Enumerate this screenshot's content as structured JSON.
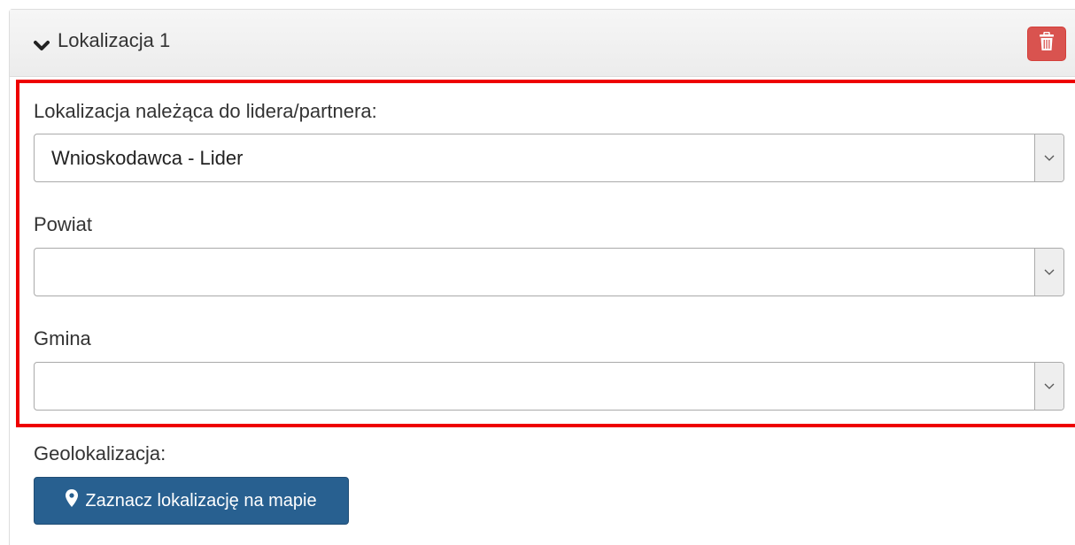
{
  "panel": {
    "title": "Lokalizacja 1",
    "chevron_icon": "chevron-down-icon",
    "delete_icon": "trash-icon",
    "delete_color": "#d9534f"
  },
  "fields": {
    "partner": {
      "label": "Lokalizacja należąca do lidera/partnera:",
      "value": "Wnioskodawca - Lider"
    },
    "powiat": {
      "label": "Powiat",
      "value": ""
    },
    "gmina": {
      "label": "Gmina",
      "value": ""
    }
  },
  "geolocation": {
    "label": "Geolokalizacja:",
    "button_label": "Zaznacz lokalizację na mapie",
    "button_icon": "map-marker-icon",
    "button_color": "#286090"
  },
  "highlight_color": "#ee0000"
}
